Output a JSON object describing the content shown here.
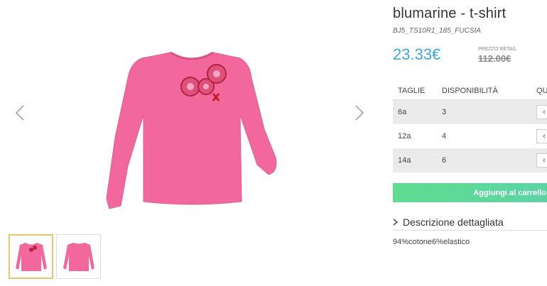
{
  "product": {
    "title": "blumarine - t-shirt",
    "sku": "BJ5_TS10R1_185_FUCSIA",
    "price": "23.33€",
    "retail_label": "PREZZO RETAIL",
    "retail_price": "112.00€"
  },
  "sizes_table": {
    "headers": [
      "TAGLIE",
      "DISPONIBILITÀ",
      "QUANTITÀ"
    ],
    "rows": [
      {
        "size": "6a",
        "availability": "3"
      },
      {
        "size": "12a",
        "availability": "4"
      },
      {
        "size": "14a",
        "availability": "6"
      }
    ]
  },
  "add_to_cart_label": "Aggiungi al carrello",
  "description": {
    "toggle_label": "Descrizione dettagliata",
    "text": "94%cotone6%elastico"
  },
  "gallery": {
    "thumbnails": [
      "front-view",
      "back-view"
    ],
    "active_thumbnail": 0
  },
  "colors": {
    "price": "#39a9e0",
    "shirt": "#f2689c",
    "cart_button": "#5fdc8f",
    "active_thumb_border": "#f0c36d"
  }
}
